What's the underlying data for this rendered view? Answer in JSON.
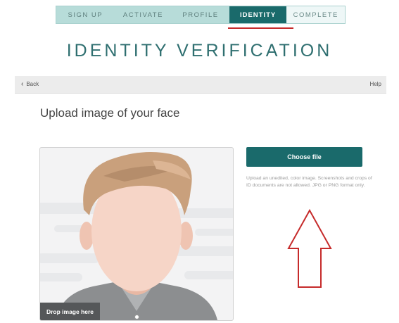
{
  "wizard": {
    "steps": [
      {
        "label": "SIGN UP"
      },
      {
        "label": "ACTIVATE"
      },
      {
        "label": "PROFILE"
      },
      {
        "label": "IDENTITY",
        "active": true
      },
      {
        "label": "COMPLETE"
      }
    ]
  },
  "page": {
    "title": "IDENTITY VERIFICATION"
  },
  "subbar": {
    "back_label": "Back",
    "help_label": "Help"
  },
  "upload": {
    "heading": "Upload image of your face",
    "drop_label": "Drop image here",
    "choose_label": "Choose file",
    "hint": "Upload an unedited, color image. Screenshots and crops of ID documents are not allowed. JPG or PNG format only."
  },
  "colors": {
    "accent": "#1a6a6b",
    "step_bar": "#b7dcd9",
    "annotation_red": "#c62b2b"
  },
  "icons": {
    "back": "chevron-left-icon",
    "avatar": "face-placeholder",
    "annotation": "arrow-up-annotation"
  }
}
